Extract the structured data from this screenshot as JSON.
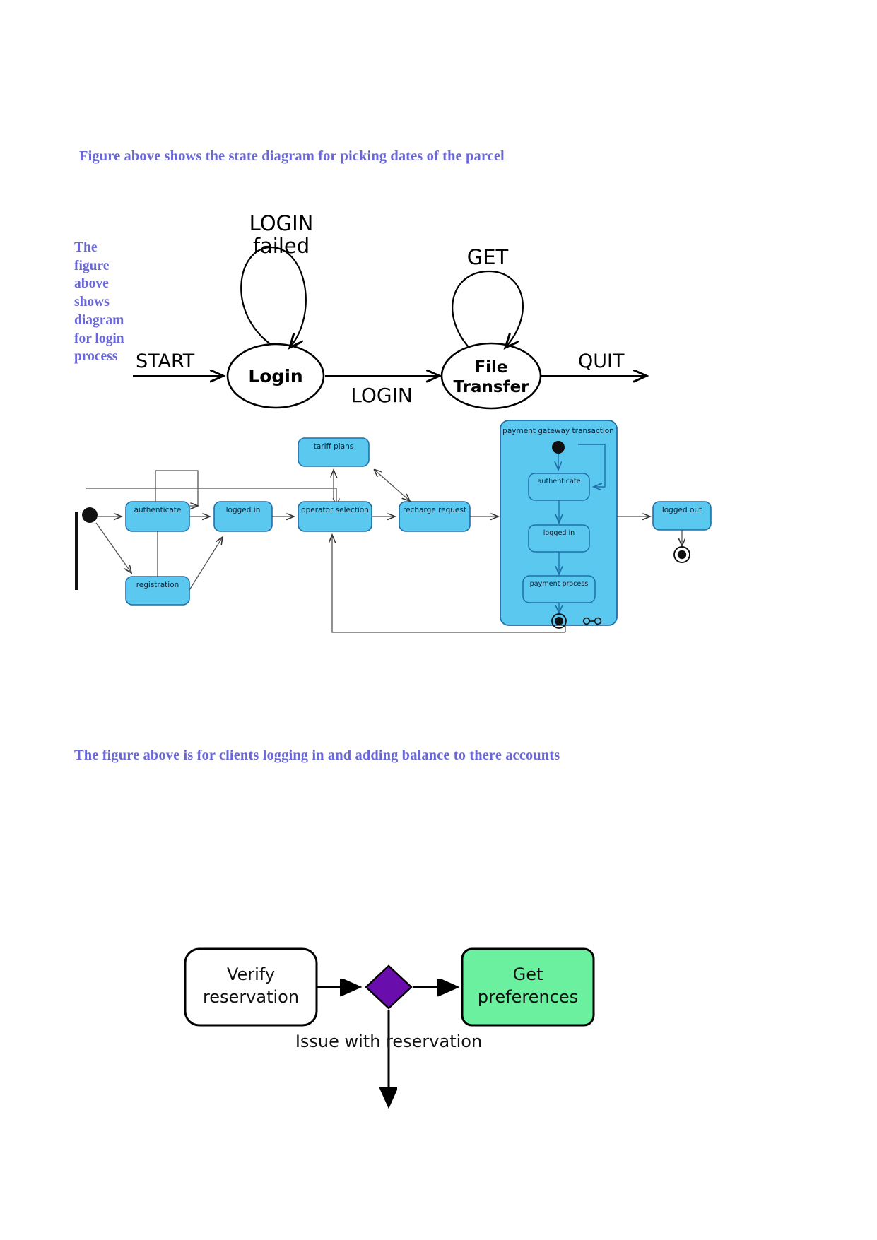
{
  "document": {
    "caption_top": "Figure above shows the state diagram for picking dates of the parcel",
    "caption_side": "The figure above shows diagram for login process",
    "caption_bottom": "The figure above is for clients logging in and adding balance to there accounts",
    "caption_color": "#6A67D8"
  },
  "ftp_diagram": {
    "name": "login-file-transfer-state-diagram",
    "states": [
      {
        "id": "login",
        "label": "Login"
      },
      {
        "id": "file_transfer",
        "label_line1": "File",
        "label_line2": "Transfer"
      }
    ],
    "transitions": [
      {
        "id": "start",
        "label": "START"
      },
      {
        "id": "login_failed",
        "label_line1": "LOGIN",
        "label_line2": "failed"
      },
      {
        "id": "login_ok",
        "label": "LOGIN"
      },
      {
        "id": "get",
        "label": "GET"
      },
      {
        "id": "quit",
        "label": "QUIT"
      }
    ],
    "stroke_color": "#000000",
    "fill_color": "#ffffff"
  },
  "activity_diagram": {
    "name": "recharge-activity-diagram",
    "node_fill": "#5BC8F0",
    "node_stroke": "#1F6FA8",
    "group_fill": "#5BC8F0",
    "nodes": [
      {
        "id": "authenticate",
        "label": "authenticate"
      },
      {
        "id": "registration",
        "label": "registration"
      },
      {
        "id": "logged_in",
        "label": "logged in"
      },
      {
        "id": "tariff_plans",
        "label": "tariff plans"
      },
      {
        "id": "operator_selection",
        "label": "operator selection"
      },
      {
        "id": "recharge_request",
        "label": "recharge request"
      },
      {
        "id": "logged_out",
        "label": "logged out"
      }
    ],
    "group": {
      "id": "payment_gateway",
      "title": "payment gateway transaction",
      "nodes": [
        {
          "id": "pg_authenticate",
          "label": "authenticate"
        },
        {
          "id": "pg_logged_in",
          "label": "logged in"
        },
        {
          "id": "pg_payment_process",
          "label": "payment process"
        }
      ]
    },
    "markers": {
      "initial": "initial-state-dot",
      "final": "final-state-circle",
      "connector": "history-connector-icon"
    }
  },
  "reservation_diagram": {
    "name": "reservation-activity-diagram",
    "nodes": [
      {
        "id": "verify_reservation",
        "label_line1": "Verify",
        "label_line2": "reservation",
        "fill": "#FFFFFF",
        "stroke": "#000000"
      },
      {
        "id": "decision",
        "label": "",
        "fill": "#6A0DAD",
        "stroke": "#000000"
      },
      {
        "id": "get_preferences",
        "label_line1": "Get",
        "label_line2": "preferences",
        "fill": "#6BF0A0",
        "stroke": "#000000"
      }
    ],
    "edges": [
      {
        "id": "issue",
        "label": "Issue with reservation"
      }
    ]
  }
}
